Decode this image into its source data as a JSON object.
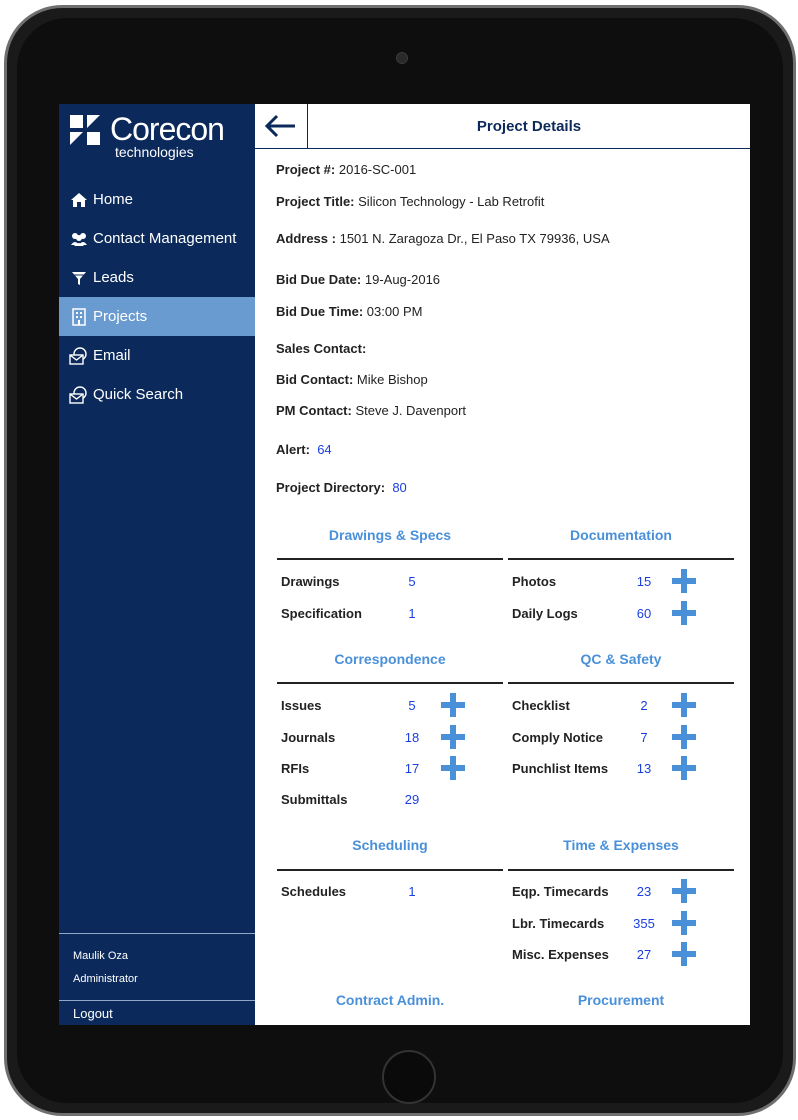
{
  "brand": {
    "name": "Corecon",
    "subtitle": "technologies"
  },
  "sidebar": {
    "items": [
      {
        "label": "Home",
        "icon": "home-icon",
        "active": false
      },
      {
        "label": "Contact Management",
        "icon": "contacts-icon",
        "active": false
      },
      {
        "label": "Leads",
        "icon": "funnel-icon",
        "active": false
      },
      {
        "label": "Projects",
        "icon": "building-icon",
        "active": true
      },
      {
        "label": "Email",
        "icon": "email-icon",
        "active": false
      },
      {
        "label": "Quick Search",
        "icon": "search-icon",
        "active": false
      }
    ],
    "user_name": "Maulik Oza",
    "user_role": "Administrator",
    "logout": "Logout"
  },
  "header": {
    "title": "Project Details",
    "back_icon": "arrow-left-icon"
  },
  "details": {
    "project_no_label": "Project #:",
    "project_no": "2016-SC-001",
    "title_label": "Project Title:",
    "title": "Silicon Technology - Lab Retrofit",
    "address_label": "Address :",
    "address": "1501 N. Zaragoza Dr., El Paso TX 79936, USA",
    "bid_due_date_label": "Bid Due Date:",
    "bid_due_date": "19-Aug-2016",
    "bid_due_time_label": "Bid Due Time:",
    "bid_due_time": "03:00 PM",
    "sales_contact_label": "Sales Contact:",
    "sales_contact": "",
    "bid_contact_label": "Bid Contact:",
    "bid_contact": "Mike Bishop",
    "pm_contact_label": "PM Contact:",
    "pm_contact": "Steve J. Davenport",
    "alert_label": "Alert:",
    "alert": "64",
    "directory_label": "Project Directory:",
    "directory": "80"
  },
  "sections": {
    "drawings": {
      "title": "Drawings & Specs",
      "items": [
        {
          "label": "Drawings",
          "count": "5"
        },
        {
          "label": "Specification",
          "count": "1"
        }
      ]
    },
    "documentation": {
      "title": "Documentation",
      "items": [
        {
          "label": "Photos",
          "count": "15"
        },
        {
          "label": "Daily Logs",
          "count": "60"
        }
      ]
    },
    "correspondence": {
      "title": "Correspondence",
      "items": [
        {
          "label": "Issues",
          "count": "5"
        },
        {
          "label": "Journals",
          "count": "18"
        },
        {
          "label": "RFIs",
          "count": "17"
        },
        {
          "label": "Submittals",
          "count": "29"
        }
      ]
    },
    "qc_safety": {
      "title": "QC & Safety",
      "items": [
        {
          "label": "Checklist",
          "count": "2"
        },
        {
          "label": "Comply Notice",
          "count": "7"
        },
        {
          "label": "Punchlist Items",
          "count": "13"
        }
      ]
    },
    "scheduling": {
      "title": "Scheduling",
      "items": [
        {
          "label": "Schedules",
          "count": "1"
        }
      ]
    },
    "time_expenses": {
      "title": "Time & Expenses",
      "items": [
        {
          "label": "Eqp. Timecards",
          "count": "23"
        },
        {
          "label": "Lbr. Timecards",
          "count": "355"
        },
        {
          "label": "Misc. Expenses",
          "count": "27"
        }
      ]
    },
    "contract_admin": {
      "title": "Contract Admin."
    },
    "procurement": {
      "title": "Procurement"
    }
  },
  "colors": {
    "sidebar": "#0b2a5b",
    "active": "#6a9bd0",
    "accent": "#4a90d9",
    "link": "#1a3fe0"
  }
}
